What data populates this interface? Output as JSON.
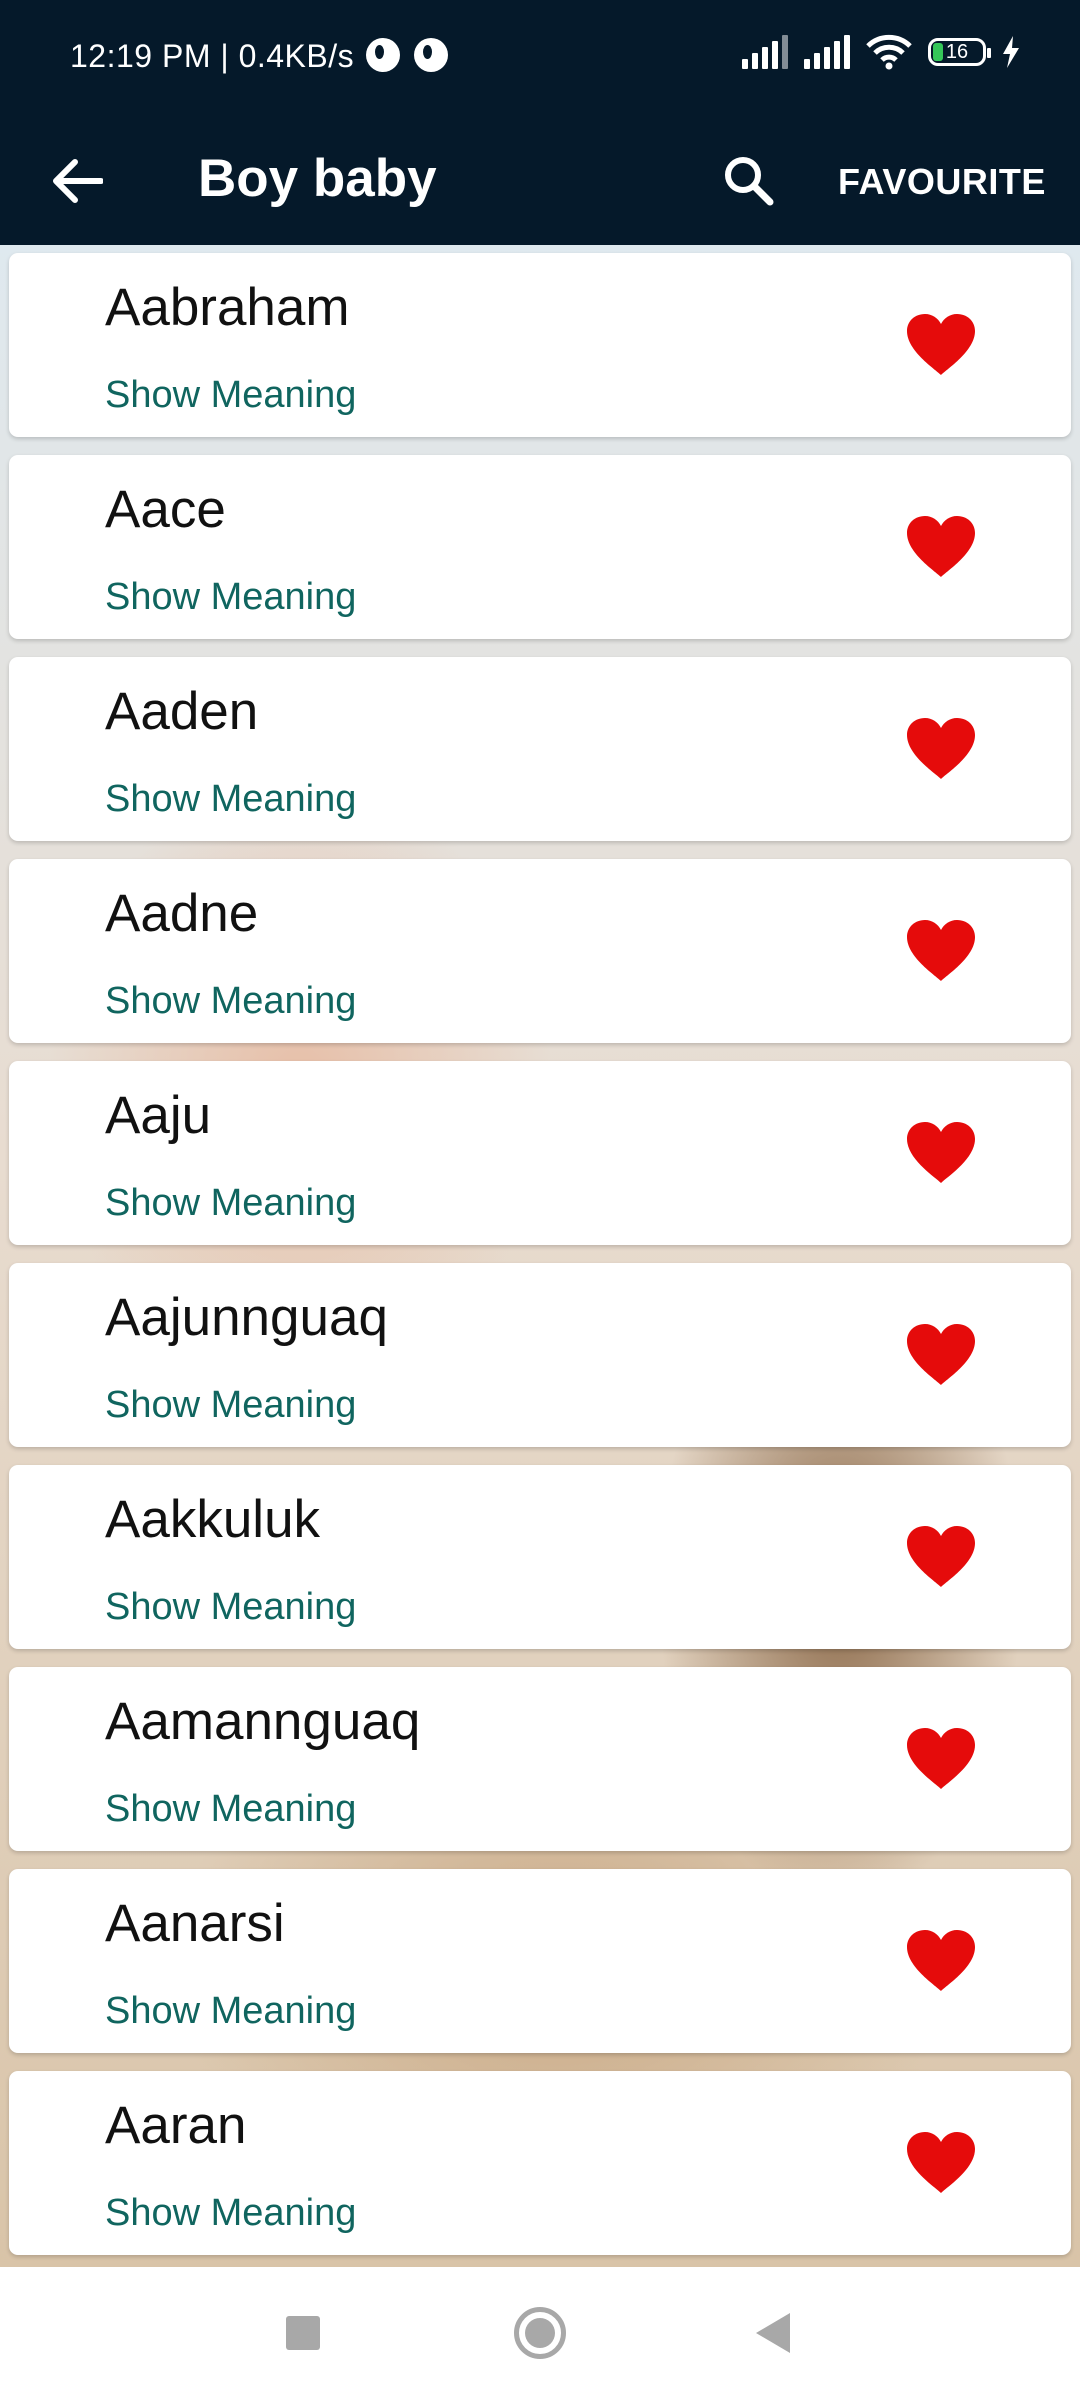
{
  "status_bar": {
    "time": "12:19 PM | 0.4KB/s",
    "battery_level": "16",
    "icons": [
      "notification-icon",
      "notification-icon",
      "signal-icon",
      "signal-icon",
      "wifi-icon",
      "battery-icon",
      "charging-icon"
    ]
  },
  "app_bar": {
    "title": "Boy baby",
    "favourite_label": "FAVOURITE",
    "background_color": "#05192a"
  },
  "names": [
    {
      "name": "Aabraham",
      "meaning_label": "Show Meaning"
    },
    {
      "name": "Aace",
      "meaning_label": "Show Meaning"
    },
    {
      "name": "Aaden",
      "meaning_label": "Show Meaning"
    },
    {
      "name": "Aadne",
      "meaning_label": "Show Meaning"
    },
    {
      "name": "Aaju",
      "meaning_label": "Show Meaning"
    },
    {
      "name": "Aajunnguaq",
      "meaning_label": "Show Meaning"
    },
    {
      "name": "Aakkuluk",
      "meaning_label": "Show Meaning"
    },
    {
      "name": "Aamannguaq",
      "meaning_label": "Show Meaning"
    },
    {
      "name": "Aanarsi",
      "meaning_label": "Show Meaning"
    },
    {
      "name": "Aaran",
      "meaning_label": "Show Meaning"
    }
  ],
  "colors": {
    "heart": "#e50b0b",
    "meaning_link": "#10655f"
  },
  "nav_bar": {
    "icons": [
      "recents-icon",
      "home-icon",
      "back-icon"
    ]
  }
}
